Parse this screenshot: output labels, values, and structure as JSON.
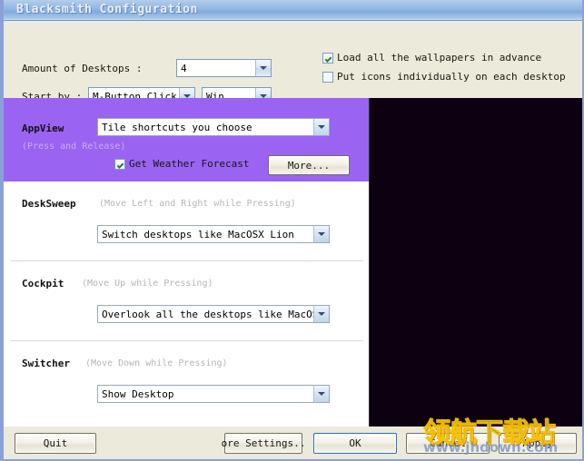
{
  "window": {
    "title": "Blacksmith Configuration"
  },
  "top": {
    "amount_label": "Amount of Desktops :",
    "amount_value": "4",
    "startby_label": "Start by :",
    "startby_value": "M-Button Click",
    "startby_modifier": "Win",
    "check_wallpapers": {
      "label": "Load all the wallpapers in advance",
      "checked": true
    },
    "check_icons": {
      "label": "Put icons individually on each desktop",
      "checked": false
    }
  },
  "sections": [
    {
      "name": "AppView",
      "hint": "(Press and Release)",
      "value": "Tile shortcuts you choose",
      "weather_label": "Get Weather Forecast",
      "weather_checked": true,
      "more_label": "More..."
    },
    {
      "name": "DeskSweep",
      "hint": "(Move Left and Right while Pressing)",
      "value": "Switch desktops like MacOSX Lion"
    },
    {
      "name": "Cockpit",
      "hint": "(Move Up while Pressing)",
      "value": "Overlook all the desktops like MacOSX"
    },
    {
      "name": "Switcher",
      "hint": "(Move Down while Pressing)",
      "value": "Show Desktop"
    }
  ],
  "buttons": {
    "quit": "Quit",
    "more_settings": "ore Settings..",
    "ok": "OK",
    "cancel": "Cancel",
    "apply": "Apply"
  },
  "watermark": {
    "text_cn": "领航下载站",
    "url": "www.jhdown.com"
  },
  "colors": {
    "titlebar": "#8FB5E2",
    "dialog_bg": "#ECEADA",
    "appview_bg": "#9B63F2",
    "preview_bg": "#0D0011",
    "check_green": "#2F7A2F"
  }
}
